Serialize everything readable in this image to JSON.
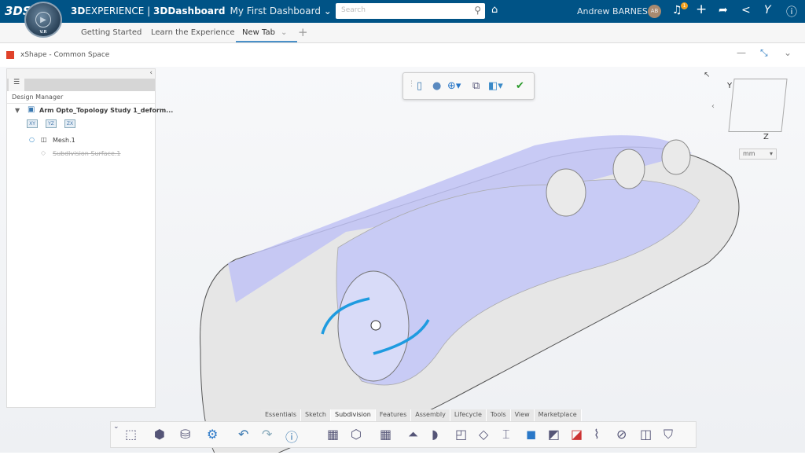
{
  "header": {
    "logo": "3DS",
    "brand_bold": "3D",
    "brand_rest": "EXPERIENCE | ",
    "app": "3DDashboard",
    "dashboard": "My First Dashboard",
    "search_placeholder": "Search",
    "user": "Andrew BARNES",
    "avatar_initials": "AB",
    "notification_count": "1",
    "compass_version": "V.R"
  },
  "tabs": [
    {
      "label": "Getting Started"
    },
    {
      "label": "Learn the Experience"
    },
    {
      "label": "New Tab",
      "active": true
    }
  ],
  "widget": {
    "title": "xShape - Common Space"
  },
  "panel": {
    "title": "Design Manager",
    "root": "Arm Opto_Topology Study 1_deform...",
    "planes": [
      "XY",
      "YZ",
      "ZX"
    ],
    "children": [
      "Mesh.1",
      "Subdivision Surface.1"
    ]
  },
  "viewport": {
    "axes": [
      "Y",
      "Z"
    ],
    "unit": "mm"
  },
  "bottom_tabs": [
    "Essentials",
    "Sketch",
    "Subdivision",
    "Features",
    "Assembly",
    "Lifecycle",
    "Tools",
    "View",
    "Marketplace"
  ],
  "active_bottom_tab": "Subdivision",
  "colors": {
    "header": "#005386",
    "accent": "#4a90c8",
    "mesh": "#b9bdf0",
    "manipulator": "#1e9be0"
  }
}
